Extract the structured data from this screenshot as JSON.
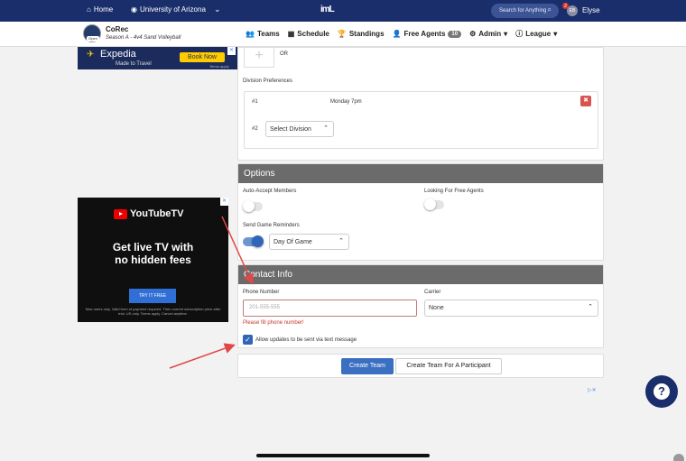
{
  "topbar": {
    "home_label": "Home",
    "university_label": "University of Arizona",
    "logo_text": "imL",
    "search_placeholder": "Search for Anything",
    "notification_count": "2",
    "avatar_initials": "EB",
    "user_name": "Elyse"
  },
  "league": {
    "name": "CoRec",
    "season": "Season A - 4v4 Sand Volleyball",
    "logo_tag": "Open"
  },
  "nav": {
    "teams": "Teams",
    "schedule": "Schedule",
    "standings": "Standings",
    "free_agents": "Free Agents",
    "free_agents_count": "10",
    "admin": "Admin",
    "league": "League"
  },
  "ads": {
    "expedia_name": "Expedia",
    "expedia_tag": "Made to Travel",
    "expedia_button": "Book Now",
    "expedia_terms": "Terms apply",
    "yt_logo": "YouTubeTV",
    "yt_headline_1": "Get live TV with",
    "yt_headline_2": "no hidden fees",
    "yt_button": "TRY IT FREE",
    "yt_fine_print": "New users only. Valid form of payment required. Then current subscription price after trial. US only. Terms apply. Cancel anytime."
  },
  "top_section": {
    "or_label": "OR",
    "division_preferences_label": "Division Preferences",
    "div1_rank": "#1",
    "div1_value": "Monday 7pm",
    "div2_rank": "#2",
    "div2_select_value": "Select Division"
  },
  "options": {
    "title": "Options",
    "auto_accept_label": "Auto-Accept Members",
    "auto_accept_on": false,
    "looking_fa_label": "Looking For Free Agents",
    "looking_fa_on": false,
    "reminders_label": "Send Game Reminders",
    "reminders_on": true,
    "reminders_select_value": "Day Of Game"
  },
  "contact": {
    "title": "Contact Info",
    "phone_label": "Phone Number",
    "phone_placeholder": "201-555-555",
    "carrier_label": "Carrier",
    "carrier_value": "None",
    "error_text": "Please fill phone number!",
    "allow_updates_label": "Allow updates to be sent via text message",
    "allow_updates_checked": true
  },
  "actions": {
    "create_team": "Create Team",
    "create_for_participant": "Create Team For A Participant"
  },
  "colors": {
    "nav_bg": "#1a2e6b",
    "panel_header": "#6b6b6b",
    "primary": "#3a6fc2",
    "danger": "#d9534f",
    "annotation_arrow": "#e04848"
  }
}
